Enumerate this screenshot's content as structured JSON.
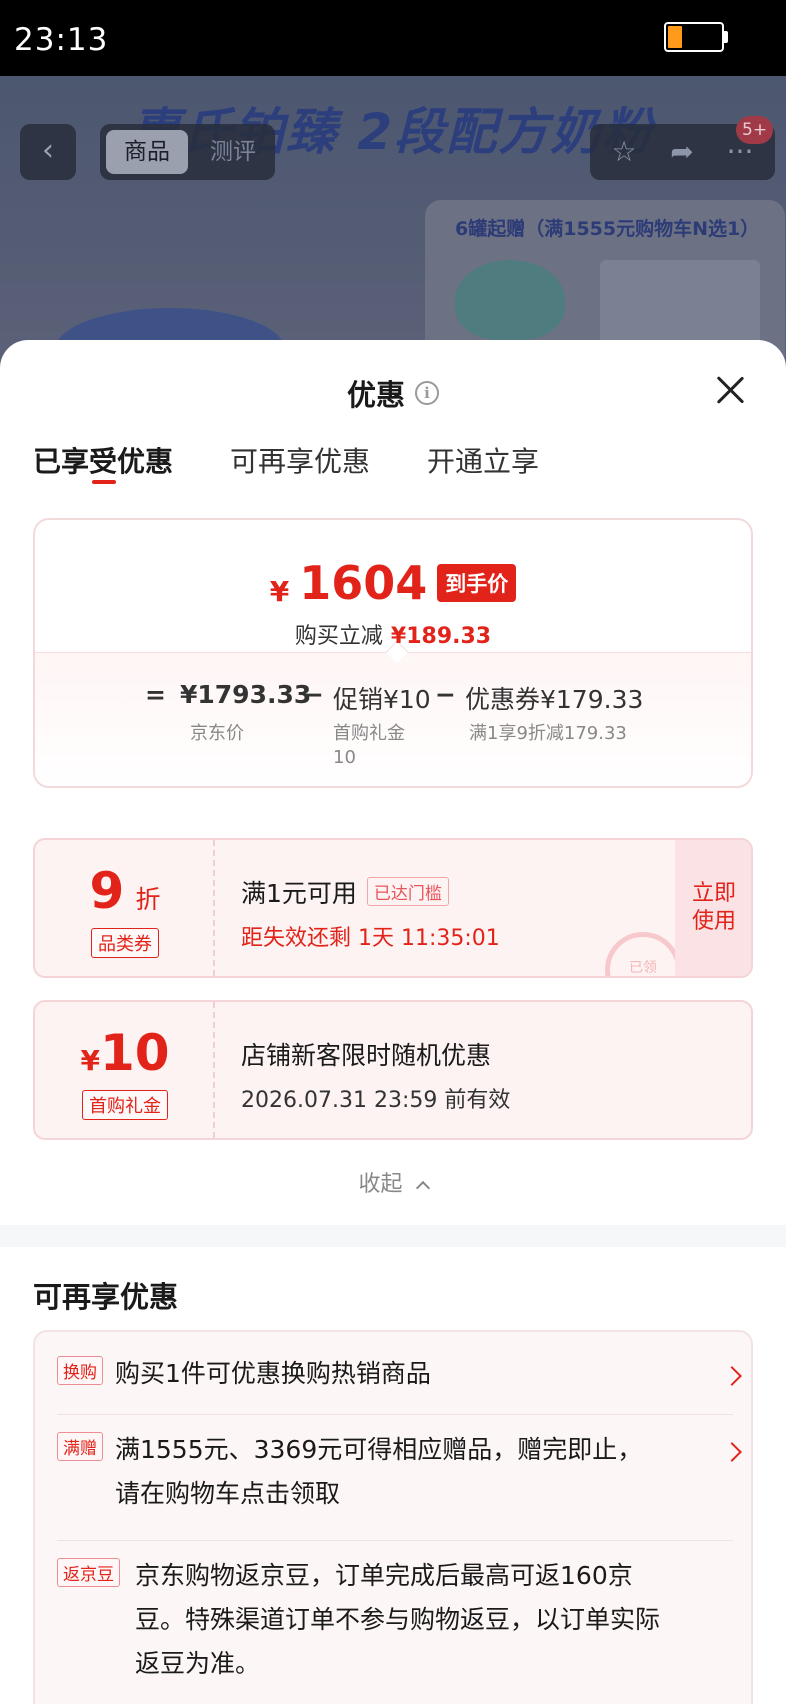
{
  "status_bar": {
    "time": "23:13"
  },
  "product_bg": {
    "headline": "惠氏铂臻 2段配方奶粉",
    "tab_goods": "商品",
    "tab_review": "测评",
    "badge": "5+",
    "promo_card_text": "6罐起赠（满1555元购物车N选1）"
  },
  "sheet": {
    "title": "优惠",
    "tabs": [
      "已享受优惠",
      "可再享优惠",
      "开通立享"
    ]
  },
  "summary": {
    "final_currency": "¥",
    "final_price": "1604",
    "final_tag": "到手价",
    "reduce_label": "购买立减",
    "reduce_amount": "¥189.33",
    "eq": "=",
    "jd_price": "¥1793.33",
    "jd_price_label": "京东价",
    "minus1": "−",
    "promo": "促销¥10",
    "promo_label_1": "首购礼金",
    "promo_label_2": "10",
    "minus2": "−",
    "coupon": "优惠券¥179.33",
    "coupon_label": "满1享9折减179.33"
  },
  "coupons": [
    {
      "value": "9",
      "unit": "折",
      "type_label": "品类券",
      "main": "满1元可用",
      "tag": "已达门槛",
      "sub": "距失效还剩 1天 11:35:01",
      "action_1": "立即",
      "action_2": "使用",
      "stamp": "已领"
    },
    {
      "currency": "¥",
      "value": "10",
      "type_label": "首购礼金",
      "main": "店铺新客限时随机优惠",
      "sub": "2026.07.31 23:59 前有效"
    }
  ],
  "collapse_label": "收起",
  "more_section": {
    "title": "可再享优惠",
    "items": [
      {
        "tag": "换购",
        "text_1": "购买1件可优惠换购热销商品"
      },
      {
        "tag": "满赠",
        "text_1": "满1555元、3369元可得相应赠品，赠完即止，",
        "text_2": "请在购物车点击领取"
      },
      {
        "tag": "返京豆",
        "text_1": "京东购物返京豆，订单完成后最高可返160京",
        "text_2": "豆。特殊渠道订单不参与购物返豆，以订单实际",
        "text_3": "返豆为准。"
      }
    ]
  },
  "colors": {
    "accent": "#e2231a",
    "coupon_bg": "#fdf3f3"
  }
}
